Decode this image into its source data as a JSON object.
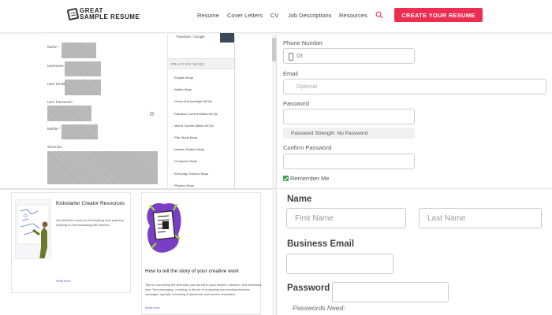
{
  "header": {
    "logo_line1": "GREAT",
    "logo_line2": "SAMPLE RESUME",
    "nav": [
      "Resume",
      "Cover Letters",
      "CV",
      "Job Descriptions",
      "Resources"
    ],
    "cta_label": "CREATE YOUR RESUME",
    "cta_color": "#ee2d52"
  },
  "profile_form": {
    "fields": [
      "Name",
      "Username",
      "User Email",
      "User Password",
      "Mobile",
      "Short Bio"
    ],
    "required_mark": "*"
  },
  "sidebar": {
    "google_text": "Translate / Google",
    "section_title": "PRACTICE MCQS",
    "items": [
      "English Mcqs",
      "Maths Mcqs",
      "General Knowledge MCQs",
      "Pakistan Current Affairs MCQs",
      "World Current Affairs MCQs",
      "Pak Study Mcqs",
      "Islamic Studies Mcqs",
      "Computer Mcqs",
      "Everyday Science Mcqs",
      "Physics Mcqs"
    ]
  },
  "cards": [
    {
      "title": "Kickstarter Creator Resources",
      "desc": "Our definitive round-up of everything from planning shipping to communicating with backers.",
      "read_more": "Read more"
    },
    {
      "title": "How to tell the story of your creative work",
      "desc": "Tips for uncovering the best story you can tell to grow funders, followers, and somebody else. Text messaging, or texting, is the act of composing and sending electronic messages, typically consisting of alphabetic and numeric characters.",
      "read_more": "Read more"
    }
  ],
  "account_form": {
    "phone_label": "Phone Number",
    "phone_value": "03",
    "email_label": "Email",
    "email_placeholder": "Optional",
    "password_label": "Password",
    "password_strength": "Password Strength: No Password",
    "confirm_label": "Confirm Password",
    "remember_label": "Remember Me",
    "remember_checked": true
  },
  "signup_form": {
    "name_label": "Name",
    "first_placeholder": "First Name",
    "last_placeholder": "Last Name",
    "business_email_label": "Business Email",
    "password_label": "Password",
    "password_needs": "Passwords Need:"
  }
}
